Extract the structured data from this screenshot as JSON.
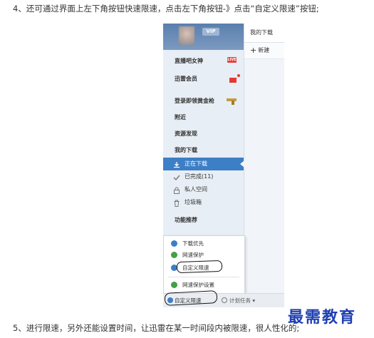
{
  "article": {
    "step4": "4、还可通过界面上左下角按钮快速限速，点击左下角按钮-》点击“自定义限速”按钮;",
    "step5": "5、进行限速，另外还能设置时间，让迅雷在某一时间段内被限速，很人性化的;"
  },
  "screenshot": {
    "header": {
      "vip_label": "VIP"
    },
    "menu": [
      {
        "label": "直播吧女神",
        "badge": "LIVE"
      },
      {
        "label": "迅雷会员",
        "icon": "gift-icon"
      },
      {
        "label": "登录即领黄金枪",
        "icon": "gun-icon"
      },
      {
        "label": "附近"
      },
      {
        "label": "资源发现"
      },
      {
        "label": "我的下载"
      }
    ],
    "downloads": [
      {
        "label": "正在下载",
        "icon": "download-icon",
        "selected": true
      },
      {
        "label": "已完成(11)",
        "icon": "check-icon"
      },
      {
        "label": "私人空间",
        "icon": "lock-icon"
      },
      {
        "label": "垃圾箱",
        "icon": "trash-icon"
      }
    ],
    "feature_label": "功能推荐",
    "topbar": {
      "tab": "我的下载"
    },
    "toolbar": {
      "new_label": "新建"
    },
    "popup": [
      {
        "label": "下载优先",
        "color": "#3d7fc6"
      },
      {
        "label": "网速保护",
        "color": "#43a047"
      },
      {
        "label": "自定义限速",
        "color": "#3d7fc6"
      },
      {
        "label": "网速保护设置",
        "color": "#43a047"
      }
    ],
    "statusbar": {
      "custom_label": "自定义限速",
      "schedule_label": "计划任务"
    }
  },
  "watermark": "最需教育",
  "colors": {
    "accent": "#3d7fc6",
    "watermark": "#1f3fb0",
    "live": "#e8413a"
  }
}
